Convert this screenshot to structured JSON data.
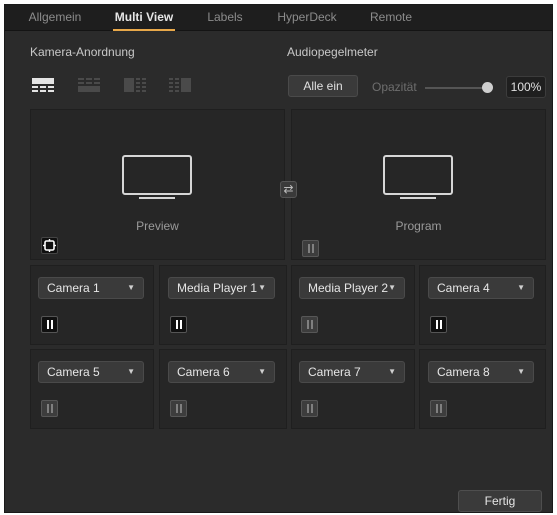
{
  "tabs": [
    {
      "label": "Allgemein",
      "active": false
    },
    {
      "label": "Multi View",
      "active": true
    },
    {
      "label": "Labels",
      "active": false
    },
    {
      "label": "HyperDeck",
      "active": false
    },
    {
      "label": "Remote",
      "active": false
    }
  ],
  "camera_layout": {
    "label": "Kamera-Anordnung",
    "selected_index": 0
  },
  "audio_meters": {
    "label": "Audiopegelmeter",
    "all_on_button": "Alle ein",
    "opacity_label": "Opazität",
    "opacity_value": "100%",
    "opacity_fraction": 1.0
  },
  "big_views": {
    "preview_label": "Preview",
    "program_label": "Program"
  },
  "cameras": [
    {
      "label": "Camera 1",
      "meter_on": true
    },
    {
      "label": "Media Player 1",
      "meter_on": true
    },
    {
      "label": "Media Player 2",
      "meter_on": false
    },
    {
      "label": "Camera 4",
      "meter_on": true
    },
    {
      "label": "Camera 5",
      "meter_on": false
    },
    {
      "label": "Camera 6",
      "meter_on": false
    },
    {
      "label": "Camera 7",
      "meter_on": false
    },
    {
      "label": "Camera 8",
      "meter_on": false
    }
  ],
  "footer": {
    "done_button": "Fertig"
  },
  "icons": {
    "swap": "swap-icon",
    "safe_area": "safe-area-icon",
    "audio_meter": "audio-meter-icon",
    "dropdown": "chevron-down-icon"
  },
  "colors": {
    "accent": "#e8a84a",
    "background": "#2b2b2b",
    "panel": "#262626"
  }
}
